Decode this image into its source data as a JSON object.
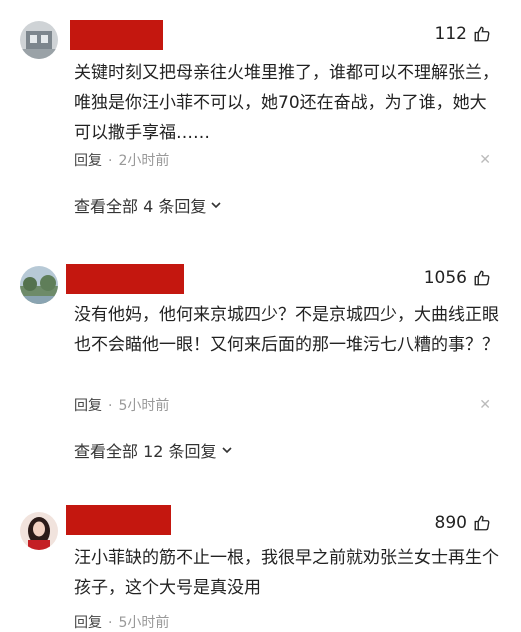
{
  "comments": [
    {
      "likes": "112",
      "text": "关键时刻又把母亲往火堆里推了，谁都可以不理解张兰，唯独是你汪小菲不可以，她70还在奋战，为了谁，她大可以撒手享福……",
      "reply_label": "回复",
      "time": "2小时前",
      "view_replies": "查看全部 4 条回复"
    },
    {
      "likes": "1056",
      "text": "没有他妈，他何来京城四少？不是京城四少，大曲线正眼也不会瞄他一眼！又何来后面的那一堆污七八糟的事？？",
      "reply_label": "回复",
      "time": "5小时前",
      "view_replies": "查看全部 12 条回复"
    },
    {
      "likes": "890",
      "text": "汪小菲缺的筋不止一根，我很早之前就劝张兰女士再生个孩子，这个大号是真没用",
      "reply_label": "回复",
      "time": "5小时前"
    }
  ],
  "icons": {
    "like": "thumb-up-icon",
    "close": "close-icon",
    "chevron": "chevron-down-icon"
  },
  "colors": {
    "redacted_name": "#c4170f"
  }
}
